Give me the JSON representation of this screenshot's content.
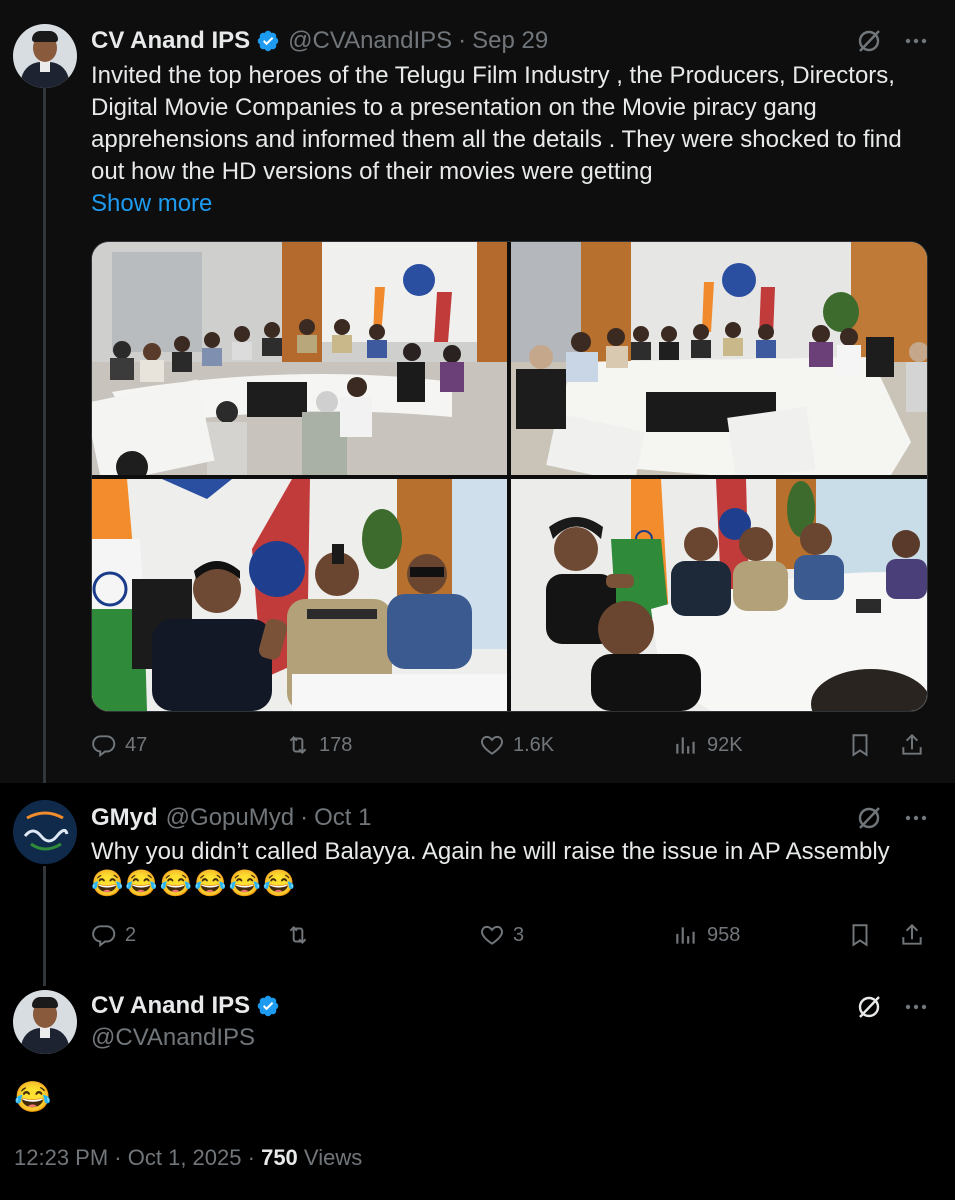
{
  "tweet1": {
    "name": "CV Anand IPS",
    "handle": "@CVAnandIPS",
    "date": "Sep 29",
    "text": "Invited the top heroes of the Telugu Film Industry , the Producers, Directors, Digital Movie Companies to a presentation on the Movie piracy gang apprehensions  and informed them all the details . They were shocked to find out how the HD versions of their movies were getting",
    "show_more": "Show more",
    "replies": "47",
    "reposts": "178",
    "likes": "1.6K",
    "views": "92K",
    "photo_alts": [
      "conference-room-wide-1",
      "conference-room-wide-2",
      "closeup-actor-and-officer",
      "closeup-attendees-clapping"
    ]
  },
  "tweet2": {
    "name": "GMyd",
    "handle": "@GopuMyd",
    "date": "Oct 1",
    "text": "Why you didn’t called Balayya. Again he will raise the issue in AP Assembly",
    "emoji": "😂😂😂😂😂😂",
    "replies": "2",
    "reposts": "",
    "likes": "3",
    "views": "958"
  },
  "tweet3": {
    "name": "CV Anand IPS",
    "handle": "@CVAnandIPS",
    "emoji": "😂",
    "time": "12:23 PM",
    "date": "Oct 1, 2025",
    "views_count": "750",
    "views_label": "Views"
  },
  "colors": {
    "accent": "#1d9bf0",
    "muted": "#71767b",
    "text": "#e7e9ea",
    "background": "#000000"
  },
  "icons": [
    "verified-badge-icon",
    "grok-icon",
    "more-icon",
    "reply-icon",
    "repost-icon",
    "like-icon",
    "views-icon",
    "bookmark-icon",
    "share-icon"
  ]
}
